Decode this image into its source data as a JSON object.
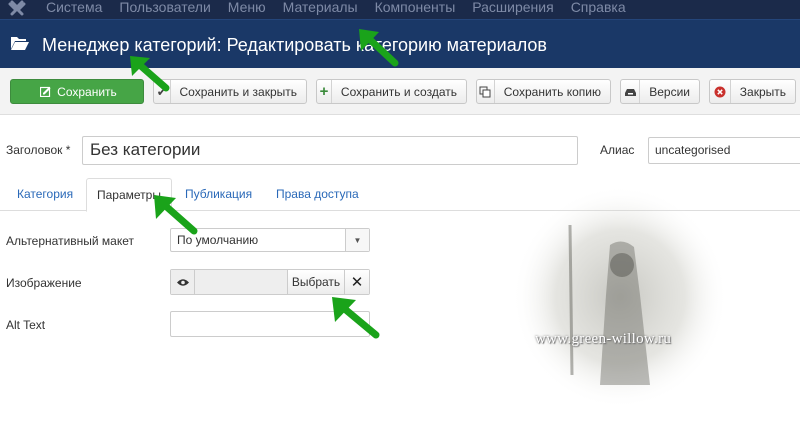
{
  "topbar": {
    "logo": "joomla-logo",
    "menu": [
      "Система",
      "Пользователи",
      "Меню",
      "Материалы",
      "Компоненты",
      "Расширения",
      "Справка"
    ]
  },
  "titlebar": {
    "icon": "folder-open-icon",
    "title": "Менеджер категорий: Редактировать категорию материалов"
  },
  "toolbar": {
    "save": "Сохранить",
    "save_close": "Сохранить и закрыть",
    "save_new": "Сохранить и создать",
    "save_copy": "Сохранить копию",
    "versions": "Версии",
    "close": "Закрыть"
  },
  "form": {
    "title_label": "Заголовок *",
    "title_value": "Без категории",
    "alias_label": "Алиас",
    "alias_value": "uncategorised"
  },
  "tabs": [
    "Категория",
    "Параметры",
    "Публикация",
    "Права доступа"
  ],
  "active_tab": "Параметры",
  "params": {
    "layout_label": "Альтернативный макет",
    "layout_value": "По умолчанию",
    "image_label": "Изображение",
    "image_choose": "Выбрать",
    "alt_label": "Alt Text",
    "alt_value": ""
  },
  "watermark": "www.green-willow.ru",
  "colors": {
    "topbar": "#1b2a4a",
    "titlebar": "#1a3867",
    "save_button": "#46a546",
    "arrow": "#1aa31a",
    "tab_link": "#2a69b8"
  }
}
